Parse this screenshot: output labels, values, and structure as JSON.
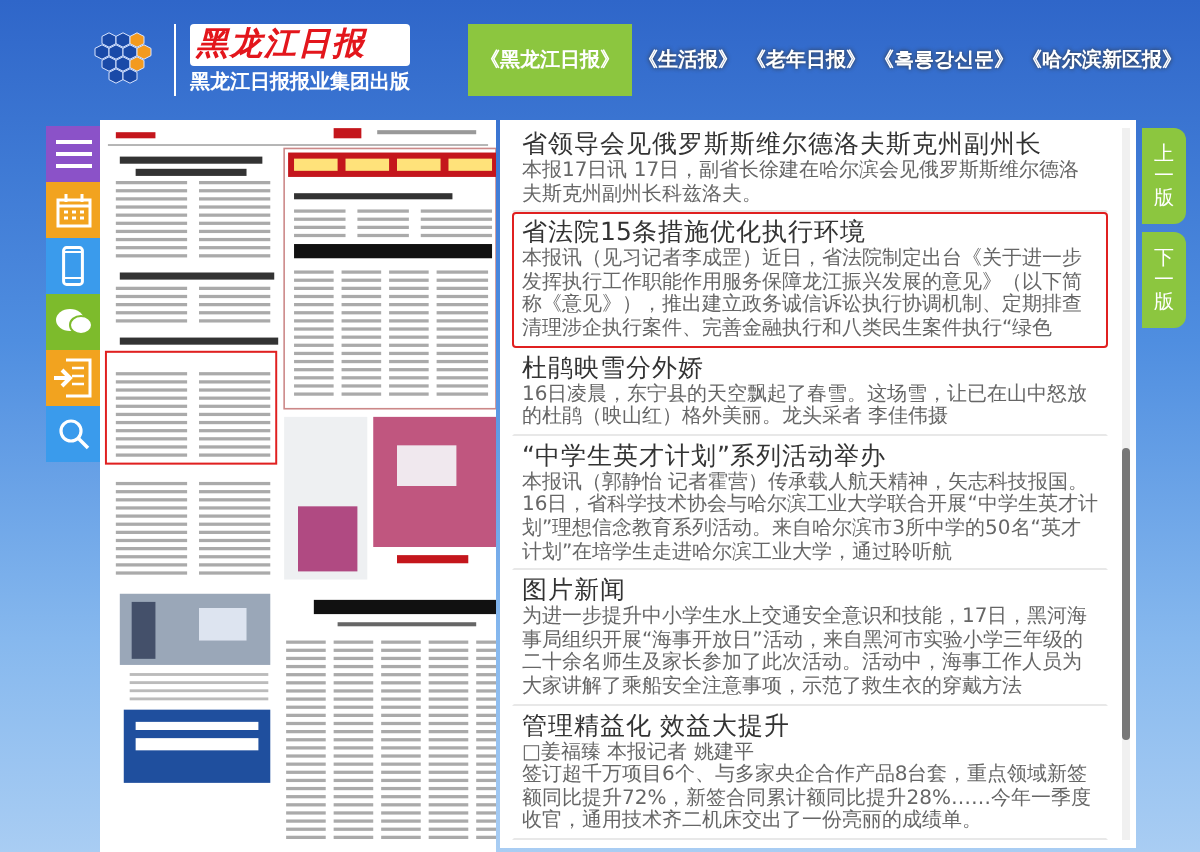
{
  "header": {
    "brand": "黑龙江日报",
    "subtitle": "黑龙江日报报业集团出版"
  },
  "tabs": [
    {
      "label": "《黑龙江日报》",
      "selected": true
    },
    {
      "label": "《生活报》",
      "selected": false
    },
    {
      "label": "《老年日报》",
      "selected": false
    },
    {
      "label": "《흑룡강신문》",
      "selected": false
    },
    {
      "label": "《哈尔滨新区报》",
      "selected": false
    }
  ],
  "sidebar": [
    {
      "kind": "menu",
      "color": "#8b52c8"
    },
    {
      "kind": "calendar",
      "color": "#f2a31f"
    },
    {
      "kind": "phone",
      "color": "#3a9bec"
    },
    {
      "kind": "chat",
      "color": "#7dbb2c"
    },
    {
      "kind": "archive",
      "color": "#f2a31f"
    },
    {
      "kind": "search",
      "color": "#3a9bec"
    }
  ],
  "articles": [
    {
      "title": "省领导会见俄罗斯斯维尔德洛夫斯克州副州长",
      "summary": "本报17日讯 17日，副省长徐建在哈尔滨会见俄罗斯斯维尔德洛夫斯克州副州长科兹洛夫。",
      "selected": false
    },
    {
      "title": "省法院15条措施优化执行环境",
      "summary": "本报讯（见习记者李成罡）近日，省法院制定出台《关于进一步发挥执行工作职能作用服务保障龙江振兴发展的意见》（以下简称《意见》），推出建立政务诚信诉讼执行协调机制、定期排查清理涉企执行案件、完善金融执行和八类民生案件执行“绿色",
      "selected": true
    },
    {
      "title": "杜鹃映雪分外娇",
      "summary": "16日凌晨，东宁县的天空飘起了春雪。这场雪，让已在山中怒放的杜鹃（映山红）格外美丽。龙头采者 李佳伟摄",
      "selected": false
    },
    {
      "title": "“中学生英才计划”系列活动举办",
      "summary": "本报讯（郭静怡 记者霍营）传承载人航天精神，矢志科技报国。16日，省科学技术协会与哈尔滨工业大学联合开展“中学生英才计划”理想信念教育系列活动。来自哈尔滨市3所中学的50名“英才计划”在培学生走进哈尔滨工业大学，通过聆听航",
      "selected": false
    },
    {
      "title": "图片新闻",
      "summary": "为进一步提升中小学生水上交通安全意识和技能，17日，黑河海事局组织开展“海事开放日”活动，来自黑河市实验小学三年级的二十余名师生及家长参加了此次活动。活动中，海事工作人员为大家讲解了乘船安全注意事项，示范了救生衣的穿戴方法",
      "selected": false
    },
    {
      "title": "管理精益化 效益大提升",
      "byline": "□姜福臻 本报记者 姚建平",
      "summary": "签订超千万项目6个、与多家央企合作产品8台套，重点领域新签额同比提升72%，新签合同累计额同比提升28%……今年一季度收官，通用技术齐二机床交出了一份亮丽的成绩单。",
      "selected": false
    }
  ],
  "page_nav": [
    {
      "label": "上一版"
    },
    {
      "label": "下一版"
    }
  ]
}
